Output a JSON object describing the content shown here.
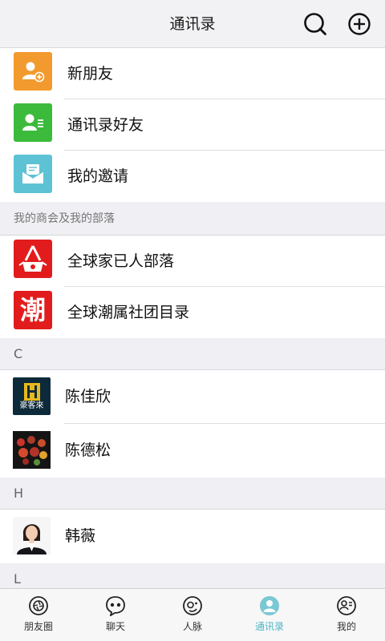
{
  "header": {
    "title": "通讯录"
  },
  "top_items": [
    {
      "label": "新朋友",
      "icon": "add-friend-icon",
      "color": "#f29a2e"
    },
    {
      "label": "通讯录好友",
      "icon": "contact-card-icon",
      "color": "#3cba3c"
    },
    {
      "label": "我的邀请",
      "icon": "invitation-envelope-icon",
      "color": "#5cc2d4"
    }
  ],
  "groups_section": {
    "title": "我的商会及我的部落",
    "items": [
      {
        "label": "全球家已人部落",
        "icon": "tribe-logo-icon",
        "color": "#e21c1c"
      },
      {
        "label": "全球潮属社团目录",
        "icon": "chao-character-logo-icon",
        "text": "潮",
        "color": "#e21c1c"
      }
    ]
  },
  "contact_groups": [
    {
      "letter": "C",
      "contacts": [
        {
          "name": "陈佳欣",
          "avatar": "hao-ke-lai-logo-avatar",
          "avatar_text": "豪客來"
        },
        {
          "name": "陈德松",
          "avatar": "food-photo-avatar"
        }
      ]
    },
    {
      "letter": "H",
      "contacts": [
        {
          "name": "韩薇",
          "avatar": "woman-portrait-avatar"
        }
      ]
    },
    {
      "letter": "L",
      "contacts": []
    }
  ],
  "tabbar": {
    "tabs": [
      {
        "label": "朋友圈",
        "icon": "camera-aperture-icon",
        "active": false
      },
      {
        "label": "聊天",
        "icon": "chat-bubble-icon",
        "active": false
      },
      {
        "label": "人脉",
        "icon": "network-face-icon",
        "active": false
      },
      {
        "label": "通讯录",
        "icon": "contacts-person-icon",
        "active": true
      },
      {
        "label": "我的",
        "icon": "profile-card-icon",
        "active": false
      }
    ],
    "active_color": "#4fb6c6"
  }
}
